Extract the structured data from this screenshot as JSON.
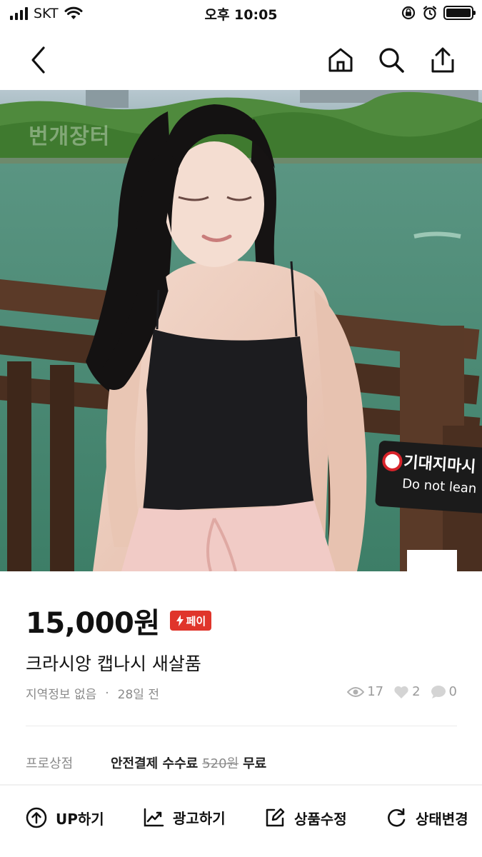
{
  "status_bar": {
    "carrier": "SKT",
    "time": "오후 10:05",
    "icons": [
      "signal-icon",
      "wifi-icon",
      "orientation-lock-icon",
      "alarm-icon",
      "battery-icon"
    ]
  },
  "header": {
    "icons": [
      "back-icon",
      "home-icon",
      "search-icon",
      "share-icon"
    ]
  },
  "product_image": {
    "watermark": "번개장터",
    "sign_korean": "기대지마시",
    "sign_english": "Do not lean"
  },
  "product": {
    "price": "15,000원",
    "pay_badge": "페이",
    "title": "크라시앙 캡나시 새살품",
    "location": "지역정보 없음",
    "separator": "·",
    "posted": "28일 전",
    "views": "17",
    "likes": "2",
    "chats": "0"
  },
  "fee": {
    "seller_type": "프로상점",
    "label": "안전결제 수수료",
    "old_fee": "520원",
    "new_fee": "무료"
  },
  "actions": [
    {
      "label": "UP하기",
      "icon": "up-arrow-circle-icon"
    },
    {
      "label": "광고하기",
      "icon": "trend-chart-icon"
    },
    {
      "label": "상품수정",
      "icon": "edit-icon"
    },
    {
      "label": "상태변경",
      "icon": "refresh-icon"
    }
  ],
  "colors": {
    "accent_red": "#e0352b",
    "muted_text": "#8a8a8a"
  }
}
